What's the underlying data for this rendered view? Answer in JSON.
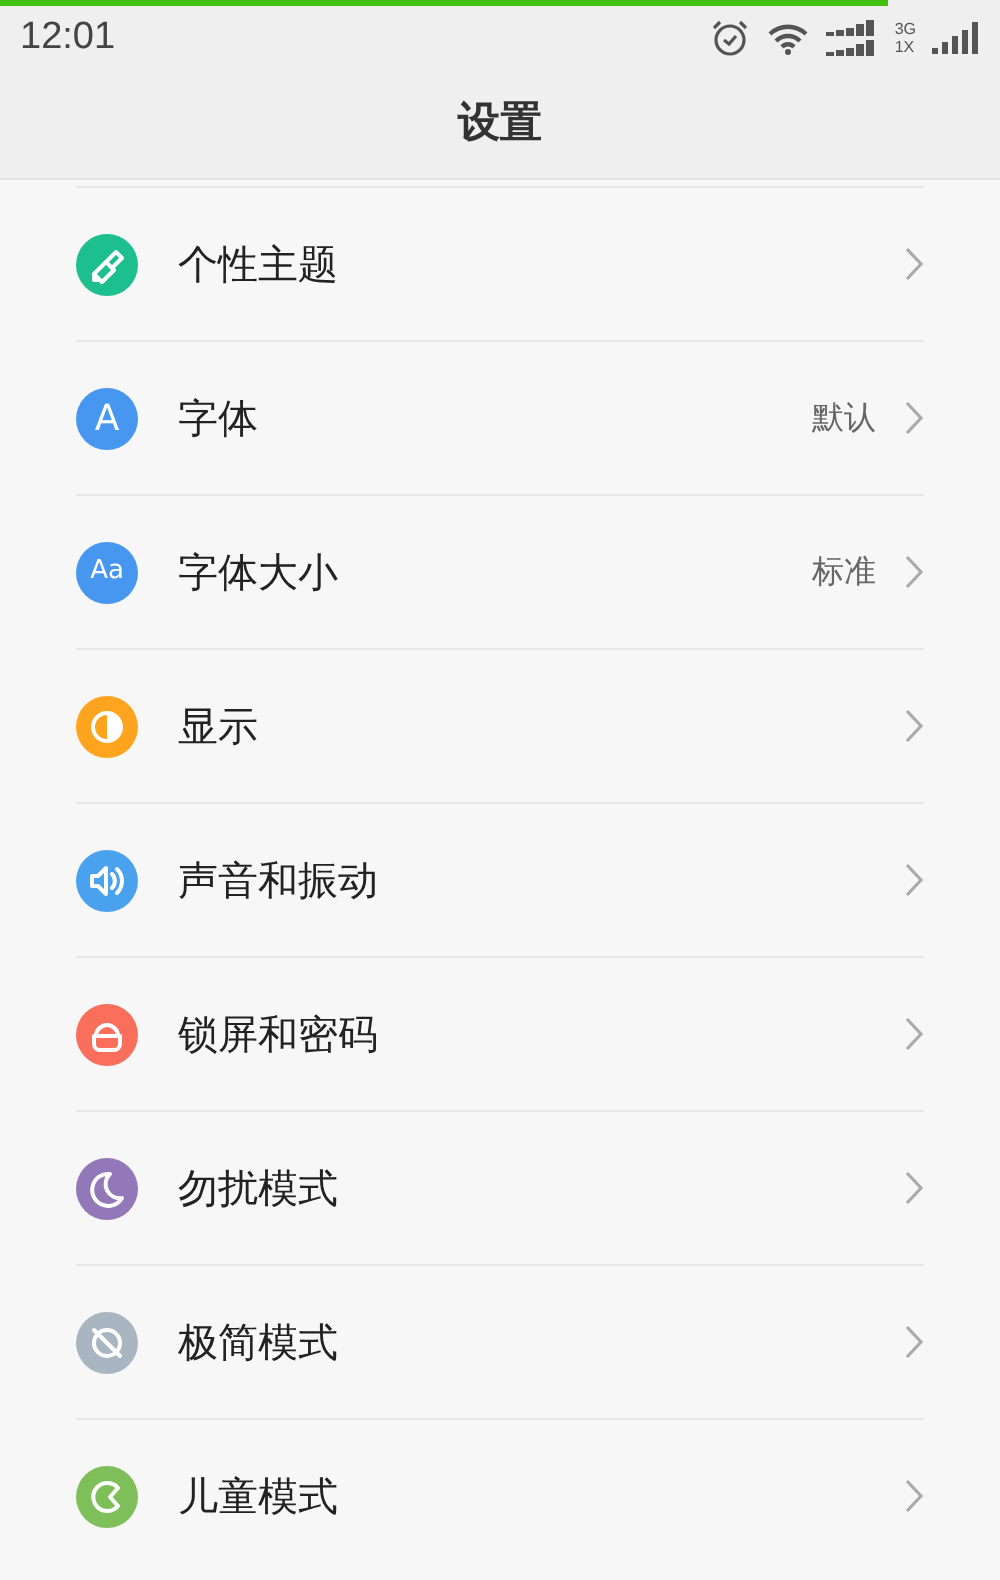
{
  "load_progress": {
    "level": 0.888
  },
  "status_bar": {
    "time": "12:01",
    "network_top": "3G",
    "network_bottom": "1X"
  },
  "title": "设置",
  "items": [
    {
      "label": "个性主题",
      "kind": "brush",
      "color": "#1dbf8f"
    },
    {
      "label": "字体",
      "kind": "letter",
      "glyph": "A",
      "color": "#4796f0",
      "value": "默认"
    },
    {
      "label": "字体大小",
      "kind": "letter",
      "glyph": "Aa",
      "color": "#4796f0",
      "value": "标准"
    },
    {
      "label": "显示",
      "kind": "contrast",
      "color": "#ffa41f"
    },
    {
      "label": "声音和振动",
      "kind": "speaker",
      "color": "#4aa2ee"
    },
    {
      "label": "锁屏和密码",
      "kind": "lock",
      "color": "#fa6e5c"
    },
    {
      "label": "勿扰模式",
      "kind": "moon",
      "color": "#9278b8"
    },
    {
      "label": "极简模式",
      "kind": "slash",
      "color": "#a9b5c0"
    },
    {
      "label": "儿童模式",
      "kind": "kid",
      "color": "#7fbf5a"
    }
  ]
}
